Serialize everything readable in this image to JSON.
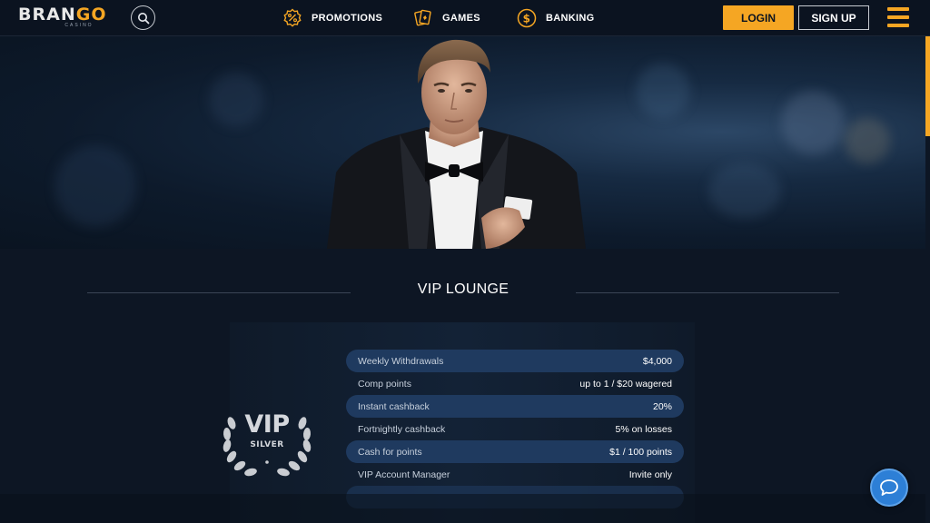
{
  "header": {
    "logo_text_a": "BRAN",
    "logo_text_b": "GO",
    "logo_sub": "CASINO",
    "nav": [
      {
        "label": "PROMOTIONS",
        "icon": "percent-badge-icon"
      },
      {
        "label": "GAMES",
        "icon": "playing-cards-icon"
      },
      {
        "label": "BANKING",
        "icon": "dollar-coin-icon"
      }
    ],
    "login_label": "LOGIN",
    "signup_label": "SIGN UP"
  },
  "colors": {
    "accent": "#f5a623",
    "background": "#0d1624",
    "row_shade": "#1f3a5f",
    "chat": "#2d7fd6"
  },
  "lounge": {
    "title": "VIP LOUNGE",
    "badge_main": "VIP",
    "badge_tier": "SILVER",
    "rows": [
      {
        "label": "Weekly Withdrawals",
        "value": "$4,000"
      },
      {
        "label": "Comp points",
        "value": "up to 1 / $20 wagered"
      },
      {
        "label": "Instant cashback",
        "value": "20%"
      },
      {
        "label": "Fortnightly cashback",
        "value": "5% on losses"
      },
      {
        "label": "Cash for points",
        "value": "$1 / 100 points"
      },
      {
        "label": "VIP Account Manager",
        "value": "Invite only"
      }
    ]
  }
}
